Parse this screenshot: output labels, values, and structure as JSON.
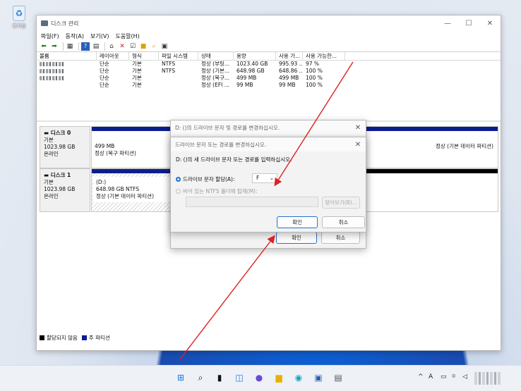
{
  "desktop": {
    "recycle_label": "휴지통"
  },
  "window": {
    "title": "디스크 관리",
    "controls": [
      "—",
      "☐",
      "✕"
    ],
    "menu": [
      "파일(F)",
      "동작(A)",
      "보기(V)",
      "도움말(H)"
    ]
  },
  "volume_table": {
    "headers": [
      "볼륨",
      "레이아웃",
      "형식",
      "파일 시스템",
      "상태",
      "용량",
      "사용 가...",
      "사용 가능한..."
    ],
    "rows": [
      [
        "",
        "단순",
        "기본",
        "NTFS",
        "정상 (부팅...",
        "1023.40 GB",
        "995.93 ...",
        "97 %"
      ],
      [
        "",
        "단순",
        "기본",
        "NTFS",
        "정상 (기본...",
        "648.98 GB",
        "648.86 ...",
        "100 %"
      ],
      [
        "",
        "단순",
        "기본",
        "",
        "정상 (복구...",
        "499 MB",
        "499 MB",
        "100 %"
      ],
      [
        "",
        "단순",
        "기본",
        "",
        "정상 (EFI ...",
        "99 MB",
        "99 MB",
        "100 %"
      ]
    ]
  },
  "disks": [
    {
      "name": "디스크 0",
      "type": "기본",
      "size": "1023.98 GB",
      "status": "온라인",
      "p1_size": "499 MB",
      "p1_status": "정상 (복구 파티션)",
      "p2_status": "정상 (기본 데이터 파티션)"
    },
    {
      "name": "디스크 1",
      "type": "기본",
      "size": "1023.98 GB",
      "status": "온라인",
      "p1_name": "(D:)",
      "p1_size": "648.98 GB NTFS",
      "p1_status": "정상 (기본 데이터 파티션)"
    }
  ],
  "legend": {
    "unallocated": "할당되지 않음",
    "primary": "주 파티션"
  },
  "dialog_back": {
    "title": "D: ()의 드라이브 문자 및 경로를 변경하십시오.",
    "ok": "확인",
    "cancel": "취소"
  },
  "dialog_front": {
    "title": "드라이브 문자 또는 경로를 변경하십시오.",
    "prompt": "D: ()의 새 드라이브 문자 또는 경로를 입력하십시오.",
    "radio_assign": "드라이브 문자 할당(A):",
    "drive_letter": "F",
    "radio_mount": "비어 있는 NTFS 폴더에 탑재(M):",
    "browse": "찾아보기(B)...",
    "ok": "확인",
    "cancel": "취소"
  },
  "taskbar": {
    "tray_chevron": "^",
    "ime": "A"
  },
  "colors": {
    "primary_partition": "#0b1d8e",
    "unallocated": "#000000",
    "arrow": "#e02020"
  }
}
